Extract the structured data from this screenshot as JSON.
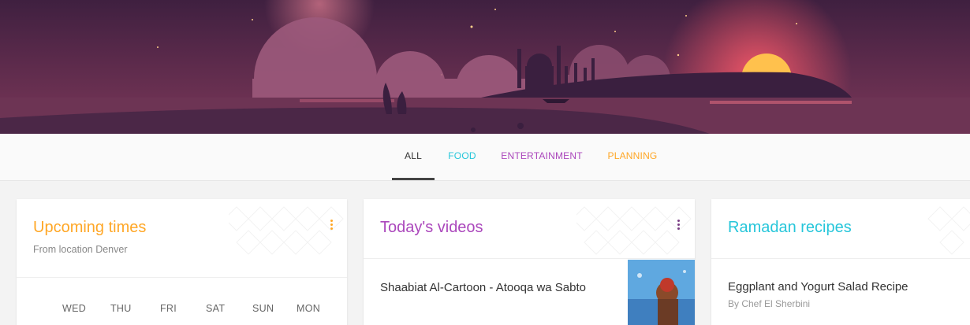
{
  "tabs": {
    "all": "ALL",
    "food": "FOOD",
    "entertainment": "ENTERTAINMENT",
    "planning": "PLANNING"
  },
  "colors": {
    "all": "#333333",
    "food": "#26c6da",
    "entertainment": "#ab47bc",
    "planning": "#ffa726"
  },
  "upcoming": {
    "title": "Upcoming times",
    "subtitle": "From location Denver",
    "days": [
      "WED",
      "THU",
      "FRI",
      "SAT",
      "SUN",
      "MON"
    ]
  },
  "videos": {
    "title": "Today's videos",
    "item_title": "Shaabiat Al-Cartoon - Atooqa wa Sabto"
  },
  "recipes": {
    "title": "Ramadan recipes",
    "item_title": "Eggplant and Yogurt Salad Recipe",
    "item_author": "By Chef El Sherbini"
  },
  "icons": {
    "menu": "more-vert-icon",
    "hero": "mosque-sunset-illustration"
  }
}
